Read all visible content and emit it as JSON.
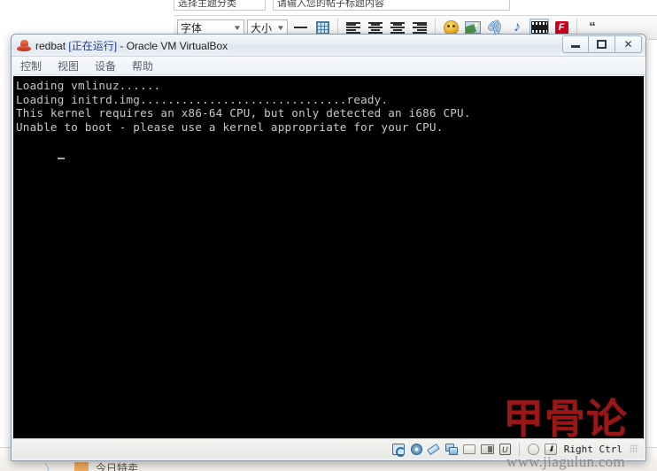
{
  "background": {
    "fields": [
      {
        "name": "category-field",
        "value": "选择主题分类"
      },
      {
        "name": "title-field",
        "value": "请输入您的帖子标题内容"
      }
    ],
    "format_toolbar": {
      "font_label": "字体",
      "size_label": "大小",
      "caret": "▼",
      "icons": [
        "horizontal-rule-icon",
        "table-icon",
        "align-left-icon",
        "align-center-icon",
        "align-middle-icon",
        "align-right-icon",
        "emoji-icon",
        "image-icon",
        "attachment-icon",
        "music-icon",
        "video-icon",
        "flash-icon",
        "quote-icon"
      ],
      "flash_label": "F"
    },
    "bottom_bar": {
      "promo_label": "今日特卖",
      "arrow": "〉"
    }
  },
  "vm_window": {
    "title_prefix": "redbat ",
    "title_status": "[正在运行]",
    "title_suffix": " - Oracle VM VirtualBox",
    "icon": "redhat-icon",
    "window_buttons": {
      "minimize": "minimize",
      "maximize": "maximize",
      "close": "✕"
    },
    "menu": [
      {
        "name": "menu-control",
        "label": "控制"
      },
      {
        "name": "menu-view",
        "label": "视图"
      },
      {
        "name": "menu-devices",
        "label": "设备"
      },
      {
        "name": "menu-help",
        "label": "帮助"
      }
    ],
    "terminal": {
      "lines": [
        "Loading vmlinuz......",
        "Loading initrd.img..............................ready.",
        "This kernel requires an x86-64 CPU, but only detected an i686 CPU.",
        "Unable to boot - please use a kernel appropriate for your CPU."
      ],
      "background_color": "#000000",
      "text_color": "#c9c9c2"
    },
    "status_bar": {
      "icons": [
        "hard-disk-icon",
        "optical-disk-icon",
        "floppy-icon",
        "network-icon",
        "shared-folder-icon",
        "display-capture-icon",
        "usb-icon",
        "mouse-integration-icon",
        "host-key-icon"
      ],
      "host_key_label": "Right Ctrl",
      "host_key_glyph": "⬇"
    }
  },
  "watermark": {
    "text": "甲骨论",
    "url": "www.jiagulun.com",
    "color": "#9b1717"
  }
}
